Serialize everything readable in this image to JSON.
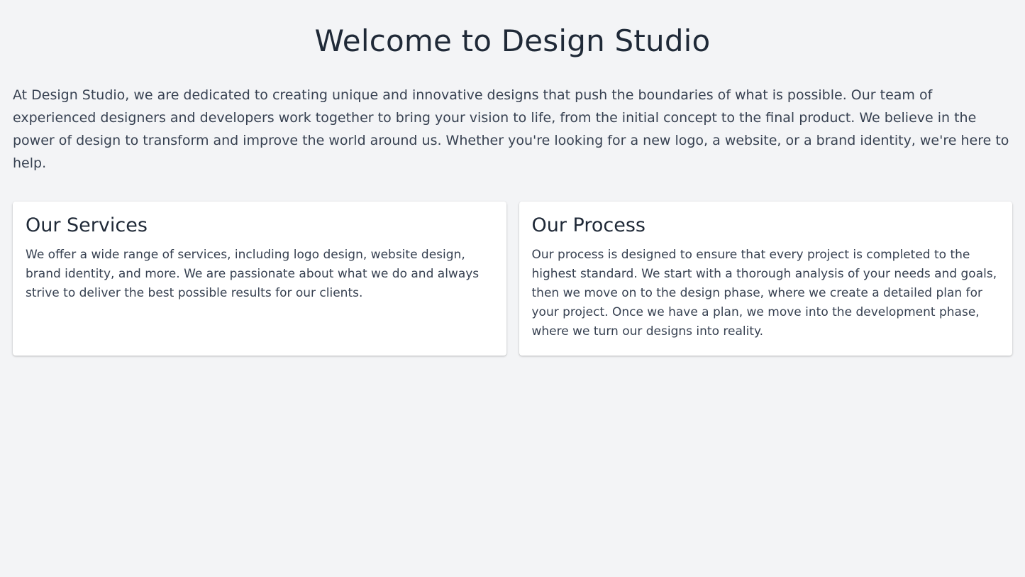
{
  "page": {
    "title": "Welcome to Design Studio",
    "intro": "At Design Studio, we are dedicated to creating unique and innovative designs that push the boundaries of what is possible. Our team of experienced designers and developers work together to bring your vision to life, from the initial concept to the final product. We believe in the power of design to transform and improve the world around us. Whether you're looking for a new logo, a website, or a brand identity, we're here to help."
  },
  "cards": [
    {
      "title": "Our Services",
      "body": "We offer a wide range of services, including logo design, website design, brand identity, and more. We are passionate about what we do and always strive to deliver the best possible results for our clients."
    },
    {
      "title": "Our Process",
      "body": "Our process is designed to ensure that every project is completed to the highest standard. We start with a thorough analysis of your needs and goals, then we move on to the design phase, where we create a detailed plan for your project. Once we have a plan, we move into the development phase, where we turn our designs into reality."
    }
  ],
  "colors": {
    "background": "#f3f4f6",
    "card": "#ffffff",
    "heading": "#1f2937",
    "text": "#374151"
  }
}
